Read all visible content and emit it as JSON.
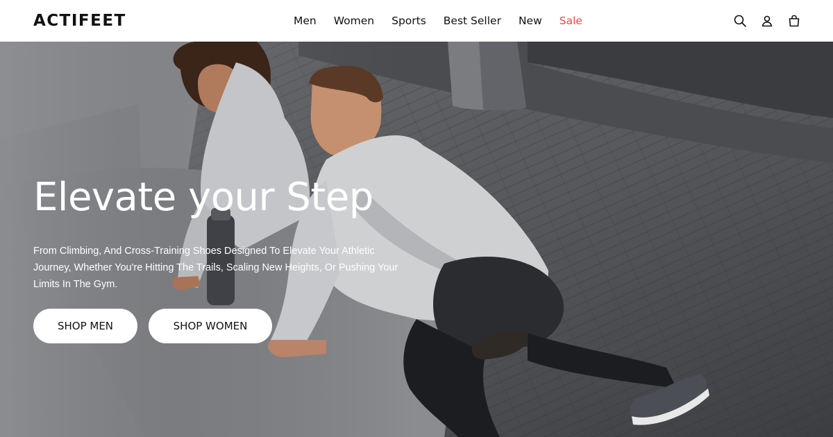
{
  "header": {
    "logo_text": "ACTIFEET",
    "nav": [
      {
        "label": "Men"
      },
      {
        "label": "Women"
      },
      {
        "label": "Sports"
      },
      {
        "label": "Best Seller"
      },
      {
        "label": "New"
      },
      {
        "label": "Sale"
      }
    ],
    "sale_color": "#e5484d",
    "icons": [
      "search-icon",
      "account-icon",
      "cart-icon"
    ]
  },
  "hero": {
    "headline": "Elevate your Step",
    "subtext": "From Climbing, And Cross-Training Shoes Designed To Elevate Your Athletic Journey, Whether You're Hitting The Trails, Scaling New Heights, Or Pushing Your Limits In The Gym.",
    "buttons": [
      {
        "label": "SHOP MEN"
      },
      {
        "label": "SHOP WOMEN"
      }
    ]
  }
}
